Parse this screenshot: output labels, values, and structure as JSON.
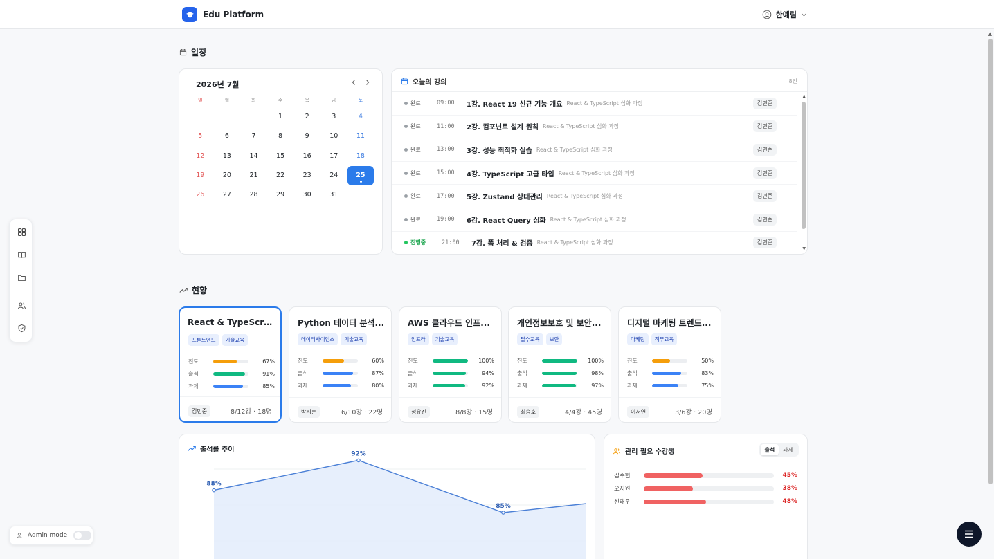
{
  "app": {
    "name": "Edu Platform",
    "user": "한예림"
  },
  "schedule": {
    "title": "일정"
  },
  "calendar": {
    "month_label": "2026년 7월",
    "weekdays": [
      "월",
      "화",
      "수",
      "목",
      "금",
      "토",
      "일"
    ],
    "days": [
      "",
      "",
      "1",
      "2",
      "3",
      "4",
      "5",
      "6",
      "7",
      "8",
      "9",
      "10",
      "11",
      "12",
      "13",
      "14",
      "15",
      "16",
      "17",
      "18",
      "19",
      "20",
      "21",
      "22",
      "23",
      "24",
      "25",
      "26",
      "27",
      "28",
      "29",
      "30",
      "31",
      "",
      ""
    ],
    "today": "25"
  },
  "lectures": {
    "title": "오늘의 강의",
    "count": "8건",
    "items": [
      {
        "status": "완료",
        "time": "09:00",
        "name": "1강. React 19 신규 기능 개요",
        "course": "React & TypeScript 심화 과정",
        "instructor": "김민준"
      },
      {
        "status": "완료",
        "time": "11:00",
        "name": "2강. 컴포넌트 설계 원칙",
        "course": "React & TypeScript 심화 과정",
        "instructor": "김민준"
      },
      {
        "status": "완료",
        "time": "13:00",
        "name": "3강. 성능 최적화 실습",
        "course": "React & TypeScript 심화 과정",
        "instructor": "김민준"
      },
      {
        "status": "완료",
        "time": "15:00",
        "name": "4강. TypeScript 고급 타입",
        "course": "React & TypeScript 심화 과정",
        "instructor": "김민준"
      },
      {
        "status": "완료",
        "time": "17:00",
        "name": "5강. Zustand 상태관리",
        "course": "React & TypeScript 심화 과정",
        "instructor": "김민준"
      },
      {
        "status": "완료",
        "time": "19:00",
        "name": "6강. React Query 심화",
        "course": "React & TypeScript 심화 과정",
        "instructor": "김민준"
      },
      {
        "status": "진행중",
        "time": "21:00",
        "name": "7강. 폼 처리 & 검증",
        "course": "React & TypeScript 심화 과정",
        "instructor": "김민준"
      }
    ]
  },
  "status": {
    "title": "현황"
  },
  "courses": [
    {
      "title": "React & TypeScri...",
      "tags": [
        "프론트엔드",
        "기술교육"
      ],
      "metrics": [
        {
          "label": "진도",
          "value": "67%",
          "pct": 67,
          "color": "#f59e0b"
        },
        {
          "label": "출석",
          "value": "91%",
          "pct": 91,
          "color": "#10b981"
        },
        {
          "label": "과제",
          "value": "85%",
          "pct": 85,
          "color": "#3b82f6"
        }
      ],
      "instructor": "김민준",
      "info": "8/12강 · 18명"
    },
    {
      "title": "Python 데이터 분석...",
      "tags": [
        "데이터사이언스",
        "기술교육"
      ],
      "metrics": [
        {
          "label": "진도",
          "value": "60%",
          "pct": 60,
          "color": "#f59e0b"
        },
        {
          "label": "출석",
          "value": "87%",
          "pct": 87,
          "color": "#3b82f6"
        },
        {
          "label": "과제",
          "value": "80%",
          "pct": 80,
          "color": "#3b82f6"
        }
      ],
      "instructor": "박지훈",
      "info": "6/10강 · 22명"
    },
    {
      "title": "AWS 클라우드 인프...",
      "tags": [
        "인프라",
        "기술교육"
      ],
      "metrics": [
        {
          "label": "진도",
          "value": "100%",
          "pct": 100,
          "color": "#10b981"
        },
        {
          "label": "출석",
          "value": "94%",
          "pct": 94,
          "color": "#10b981"
        },
        {
          "label": "과제",
          "value": "92%",
          "pct": 92,
          "color": "#10b981"
        }
      ],
      "instructor": "정유진",
      "info": "8/8강 · 15명"
    },
    {
      "title": "개인정보보호 및 보안...",
      "tags": [
        "필수교육",
        "보안"
      ],
      "metrics": [
        {
          "label": "진도",
          "value": "100%",
          "pct": 100,
          "color": "#10b981"
        },
        {
          "label": "출석",
          "value": "98%",
          "pct": 98,
          "color": "#10b981"
        },
        {
          "label": "과제",
          "value": "97%",
          "pct": 97,
          "color": "#10b981"
        }
      ],
      "instructor": "최승호",
      "info": "4/4강 · 45명"
    },
    {
      "title": "디지털 마케팅 트렌드...",
      "tags": [
        "마케팅",
        "직무교육"
      ],
      "metrics": [
        {
          "label": "진도",
          "value": "50%",
          "pct": 50,
          "color": "#f59e0b"
        },
        {
          "label": "출석",
          "value": "83%",
          "pct": 83,
          "color": "#3b82f6"
        },
        {
          "label": "과제",
          "value": "75%",
          "pct": 75,
          "color": "#3b82f6"
        }
      ],
      "instructor": "이서연",
      "info": "3/6강 · 20명"
    }
  ],
  "attendance_chart": {
    "title": "출석률 추이"
  },
  "chart_data": {
    "type": "area",
    "title": "출석률 추이",
    "series": [
      {
        "values": [
          88,
          92,
          85
        ],
        "labels": [
          "88%",
          "92%",
          "85%"
        ]
      }
    ],
    "ylim": [
      80,
      95
    ],
    "grid": true
  },
  "needs_attention": {
    "title": "관리 필요 수강생",
    "tabs": [
      "출석",
      "과제"
    ],
    "active_tab": "출석",
    "students": [
      {
        "name": "김수현",
        "value": "45%",
        "pct": 45
      },
      {
        "name": "오지원",
        "value": "38%",
        "pct": 38
      },
      {
        "name": "신태우",
        "value": "48%",
        "pct": 48
      }
    ]
  },
  "admin": {
    "label": "Admin mode"
  }
}
